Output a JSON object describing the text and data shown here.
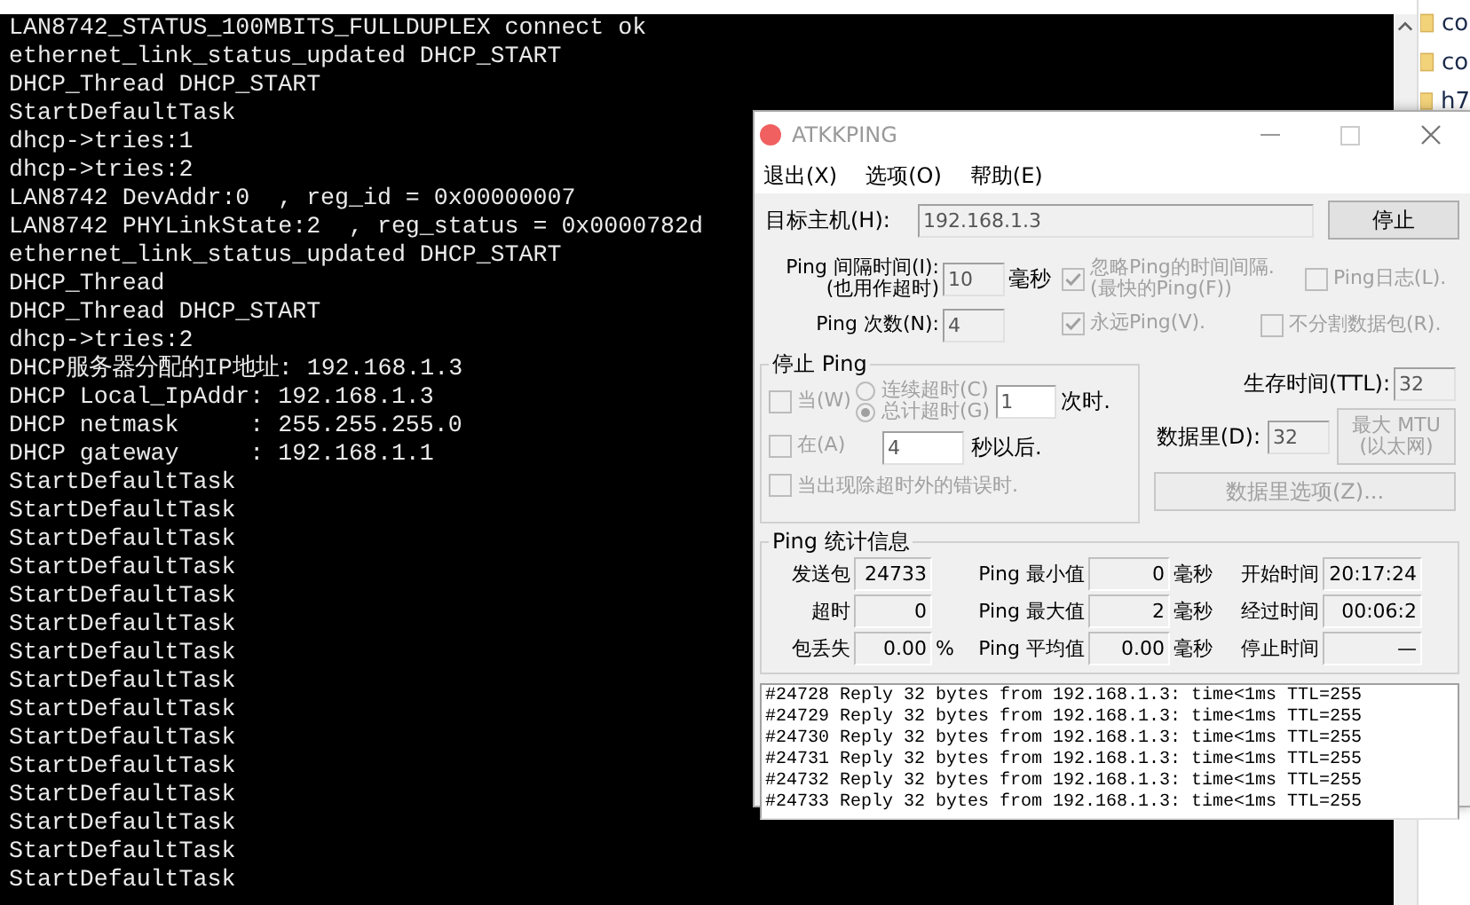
{
  "console": {
    "lines": [
      "LAN8742_STATUS_100MBITS_FULLDUPLEX connect ok",
      "ethernet_link_status_updated DHCP_START",
      "DHCP_Thread DHCP_START",
      "StartDefaultTask",
      "dhcp->tries:1",
      "dhcp->tries:2",
      "LAN8742 DevAddr:0  , reg_id = 0x00000007",
      "LAN8742 PHYLinkState:2  , reg_status = 0x0000782d",
      "ethernet_link_status_updated DHCP_START",
      "DHCP_Thread",
      "DHCP_Thread DHCP_START",
      "dhcp->tries:2",
      "DHCP服务器分配的IP地址: 192.168.1.3",
      "DHCP Local_IpAddr: 192.168.1.3",
      "DHCP netmask     : 255.255.255.0",
      "DHCP gateway     : 192.168.1.1",
      "StartDefaultTask",
      "StartDefaultTask",
      "StartDefaultTask",
      "StartDefaultTask",
      "StartDefaultTask",
      "StartDefaultTask",
      "StartDefaultTask",
      "StartDefaultTask",
      "StartDefaultTask",
      "StartDefaultTask",
      "StartDefaultTask",
      "StartDefaultTask",
      "StartDefaultTask",
      "StartDefaultTask",
      "StartDefaultTask"
    ]
  },
  "explorer": {
    "items": [
      "co",
      "co",
      "h7"
    ]
  },
  "ping_window": {
    "title": "ATKKPING",
    "active": false,
    "menu": [
      "退出(X)",
      "选项(O)",
      "帮助(E)"
    ],
    "target": {
      "label": "目标主机(H):",
      "value": "192.168.1.3"
    },
    "stop_button": "停止",
    "interval": {
      "lines": [
        "Ping 间隔时间(I):",
        "(也用作超时)"
      ],
      "value": "10",
      "unit": "毫秒"
    },
    "count": {
      "label": "Ping 次数(N):",
      "value": "4"
    },
    "options": [
      {
        "lines": [
          "忽略Ping的时间间隔.",
          "(最快的Ping(F))"
        ],
        "checked": true,
        "disabled": true
      },
      {
        "lines": [
          "Ping日志(L)."
        ],
        "checked": false,
        "disabled": true
      },
      {
        "lines": [
          "永远Ping(V)."
        ],
        "checked": true,
        "disabled": true
      },
      {
        "lines": [
          "不分割数据包(R)."
        ],
        "checked": false,
        "disabled": true
      }
    ],
    "stop_group": {
      "title": "停止 Ping",
      "when": {
        "lines": [
          "当(W)"
        ],
        "checked": false,
        "disabled": true
      },
      "radios": [
        {
          "label": "连续超时(C)",
          "selected": false
        },
        {
          "label": "总计超时(G)",
          "selected": true
        }
      ],
      "times_value": "1",
      "times_unit": "次时.",
      "after": {
        "lines": [
          "在(A)"
        ],
        "checked": false,
        "disabled": true
      },
      "after_value": "4",
      "after_unit": "秒以后.",
      "on_error": {
        "lines": [
          "当出现除超时外的错误时."
        ],
        "checked": false,
        "disabled": true
      }
    },
    "ttl": {
      "label": "生存时间(TTL):",
      "value": "32"
    },
    "data_size": {
      "label": "数据里(D):",
      "value": "32"
    },
    "mtu_button": {
      "lines": [
        "最大 MTU",
        "(以太网)"
      ],
      "disabled": true
    },
    "data_options_button": {
      "label": "数据里选项(Z)...",
      "disabled": true
    },
    "stats": {
      "title": "Ping  统计信息",
      "rows": [
        {
          "cells": [
            {
              "label": "发送包",
              "value": "24733"
            },
            {
              "label": "Ping 最小值",
              "value": "0",
              "unit": "毫秒"
            },
            {
              "label": "开始时间",
              "value": "20:17:24"
            }
          ]
        },
        {
          "cells": [
            {
              "label": "超时",
              "value": "0"
            },
            {
              "label": "Ping 最大值",
              "value": "2",
              "unit": "毫秒"
            },
            {
              "label": "经过时间",
              "value": "00:06:2"
            }
          ]
        },
        {
          "cells": [
            {
              "label": "包丢失",
              "value": "0.00",
              "unit": "%"
            },
            {
              "label": "Ping 平均值",
              "value": "0.00",
              "unit": "毫秒"
            },
            {
              "label": "停止时间",
              "value": "—"
            }
          ]
        }
      ]
    },
    "log": [
      "#24728 Reply 32 bytes from 192.168.1.3: time<1ms TTL=255",
      "#24729 Reply 32 bytes from 192.168.1.3: time<1ms TTL=255",
      "#24730 Reply 32 bytes from 192.168.1.3: time<1ms TTL=255",
      "#24731 Reply 32 bytes from 192.168.1.3: time<1ms TTL=255",
      "#24732 Reply 32 bytes from 192.168.1.3: time<1ms TTL=255",
      "#24733 Reply 32 bytes from 192.168.1.3: time<1ms TTL=255"
    ]
  }
}
